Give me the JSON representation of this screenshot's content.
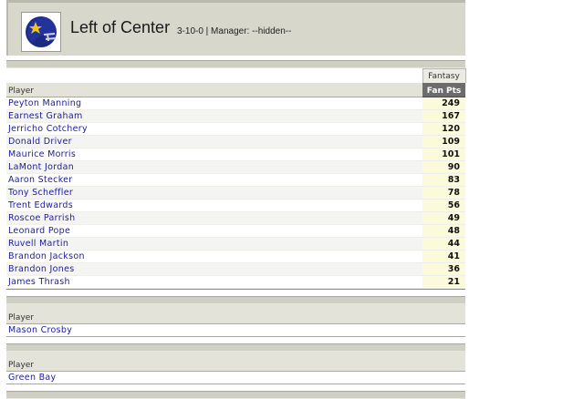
{
  "team": {
    "name": "Left of Center",
    "meta": "3-10-0 | Manager: --hidden--"
  },
  "colors": {
    "header_bg": "#d7d7cb",
    "link": "#1a1aa6",
    "fan_pts_header_bg": "#6c6c6c",
    "points_bg": "#fbfbdc"
  },
  "offense": {
    "group_label": "Fantasy",
    "player_header": "Player",
    "points_header": "Fan Pts",
    "players": [
      {
        "name": "Peyton Manning",
        "pts": "249"
      },
      {
        "name": "Earnest Graham",
        "pts": "167"
      },
      {
        "name": "Jerricho Cotchery",
        "pts": "120"
      },
      {
        "name": "Donald Driver",
        "pts": "109"
      },
      {
        "name": "Maurice Morris",
        "pts": "101"
      },
      {
        "name": "LaMont Jordan",
        "pts": "90"
      },
      {
        "name": "Aaron Stecker",
        "pts": "83"
      },
      {
        "name": "Tony Scheffler",
        "pts": "78"
      },
      {
        "name": "Trent Edwards",
        "pts": "56"
      },
      {
        "name": "Roscoe Parrish",
        "pts": "49"
      },
      {
        "name": "Leonard Pope",
        "pts": "48"
      },
      {
        "name": "Ruvell Martin",
        "pts": "44"
      },
      {
        "name": "Brandon Jackson",
        "pts": "41"
      },
      {
        "name": "Brandon Jones",
        "pts": "36"
      },
      {
        "name": "James Thrash",
        "pts": "21"
      }
    ]
  },
  "kicker": {
    "player_header": "Player",
    "players": [
      {
        "name": "Mason Crosby"
      }
    ]
  },
  "defense": {
    "player_header": "Player",
    "players": [
      {
        "name": "Green Bay"
      }
    ]
  }
}
